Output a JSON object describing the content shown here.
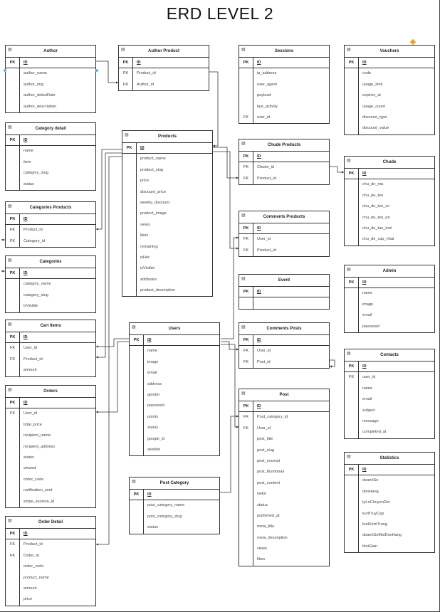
{
  "title": "ERD LEVEL 2",
  "colors": {
    "line": "#333333",
    "accent": "#f0a020",
    "handle": "#5ab4e8"
  },
  "entities": [
    {
      "id": "author",
      "name": "Author",
      "fields": [
        {
          "key": "PK",
          "name": "ID"
        },
        {
          "key": "",
          "name": "author_name"
        },
        {
          "key": "",
          "name": "author_img"
        },
        {
          "key": "",
          "name": "author_debutDate"
        },
        {
          "key": "",
          "name": "author_description"
        }
      ]
    },
    {
      "id": "author_product",
      "name": "Author Product",
      "fields": [
        {
          "key": "PK",
          "name": "ID"
        },
        {
          "key": "FK",
          "name": "Product_id"
        },
        {
          "key": "FK",
          "name": "Author_id"
        }
      ]
    },
    {
      "id": "sessions",
      "name": "Sessions",
      "fields": [
        {
          "key": "PK",
          "name": "ID"
        },
        {
          "key": "",
          "name": "ip_address"
        },
        {
          "key": "",
          "name": "user_agent"
        },
        {
          "key": "",
          "name": "payload"
        },
        {
          "key": "",
          "name": "last_activity"
        },
        {
          "key": "FK",
          "name": "user_id"
        }
      ]
    },
    {
      "id": "vouchers",
      "name": "Vouchers",
      "fields": [
        {
          "key": "PK",
          "name": "ID"
        },
        {
          "key": "",
          "name": "code"
        },
        {
          "key": "",
          "name": "usage_limit"
        },
        {
          "key": "",
          "name": "expires_at"
        },
        {
          "key": "",
          "name": "usage_count"
        },
        {
          "key": "",
          "name": "discount_type"
        },
        {
          "key": "",
          "name": "discount_value"
        }
      ]
    },
    {
      "id": "category_detail",
      "name": "Category detail",
      "fields": [
        {
          "key": "PK",
          "name": "ID"
        },
        {
          "key": "",
          "name": "name"
        },
        {
          "key": "",
          "name": "item"
        },
        {
          "key": "",
          "name": "category_slug"
        },
        {
          "key": "",
          "name": "status"
        }
      ]
    },
    {
      "id": "products",
      "name": "Products",
      "fields": [
        {
          "key": "PK",
          "name": "ID"
        },
        {
          "key": "",
          "name": "product_name"
        },
        {
          "key": "",
          "name": "product_slug"
        },
        {
          "key": "",
          "name": "price"
        },
        {
          "key": "",
          "name": "discount_price"
        },
        {
          "key": "",
          "name": "weekly_discount"
        },
        {
          "key": "",
          "name": "product_image"
        },
        {
          "key": "",
          "name": "views"
        },
        {
          "key": "",
          "name": "likes"
        },
        {
          "key": "",
          "name": "remaining"
        },
        {
          "key": "",
          "name": "isHot"
        },
        {
          "key": "",
          "name": "isVisible"
        },
        {
          "key": "",
          "name": "attributes"
        },
        {
          "key": "",
          "name": "product_description"
        }
      ]
    },
    {
      "id": "chude_products",
      "name": "Chude Products",
      "fields": [
        {
          "key": "PK",
          "name": "ID"
        },
        {
          "key": "FK",
          "name": "Chude_id"
        },
        {
          "key": "FK",
          "name": "Product_id"
        }
      ]
    },
    {
      "id": "chude",
      "name": "Chude",
      "fields": [
        {
          "key": "PK",
          "name": "ID"
        },
        {
          "key": "",
          "name": "chu_de_ma"
        },
        {
          "key": "",
          "name": "chu_de_ten"
        },
        {
          "key": "",
          "name": "chu_de_ten_vn"
        },
        {
          "key": "",
          "name": "chu_de_ten_en"
        },
        {
          "key": "",
          "name": "chu_de_tao_moi"
        },
        {
          "key": "",
          "name": "chu_de_cap_nhat"
        }
      ]
    },
    {
      "id": "categories_products",
      "name": "Categories Products",
      "fields": [
        {
          "key": "PK",
          "name": "ID"
        },
        {
          "key": "FK",
          "name": "Product_id"
        },
        {
          "key": "FK",
          "name": "Category_id"
        }
      ]
    },
    {
      "id": "comments_products",
      "name": "Comments Products",
      "fields": [
        {
          "key": "PK",
          "name": "ID"
        },
        {
          "key": "FK",
          "name": "User_id"
        },
        {
          "key": "FK",
          "name": "Product_id"
        }
      ]
    },
    {
      "id": "categories",
      "name": "Categories",
      "fields": [
        {
          "key": "PK",
          "name": "ID"
        },
        {
          "key": "",
          "name": "category_name"
        },
        {
          "key": "",
          "name": "category_slug"
        },
        {
          "key": "",
          "name": "isVisible"
        }
      ]
    },
    {
      "id": "event",
      "name": "Event",
      "fields": [
        {
          "key": "PK",
          "name": "ID"
        },
        {
          "key": "",
          "name": ""
        }
      ]
    },
    {
      "id": "admin",
      "name": "Admin",
      "fields": [
        {
          "key": "PK",
          "name": "ID"
        },
        {
          "key": "",
          "name": "name"
        },
        {
          "key": "",
          "name": "image"
        },
        {
          "key": "",
          "name": "email"
        },
        {
          "key": "",
          "name": "password"
        }
      ]
    },
    {
      "id": "cart_items",
      "name": "Cart Items",
      "fields": [
        {
          "key": "PK",
          "name": "ID"
        },
        {
          "key": "FK",
          "name": "User_id"
        },
        {
          "key": "FK",
          "name": "Product_id"
        },
        {
          "key": "",
          "name": "amount"
        }
      ]
    },
    {
      "id": "users",
      "name": "Users",
      "fields": [
        {
          "key": "PK",
          "name": "ID"
        },
        {
          "key": "",
          "name": "name"
        },
        {
          "key": "",
          "name": "image"
        },
        {
          "key": "",
          "name": "email"
        },
        {
          "key": "",
          "name": "address"
        },
        {
          "key": "",
          "name": "gender"
        },
        {
          "key": "",
          "name": "password"
        },
        {
          "key": "",
          "name": "points"
        },
        {
          "key": "",
          "name": "status"
        },
        {
          "key": "",
          "name": "google_id"
        },
        {
          "key": "",
          "name": "wishlist"
        }
      ]
    },
    {
      "id": "comments_posts",
      "name": "Comments Posts",
      "fields": [
        {
          "key": "PK",
          "name": "ID"
        },
        {
          "key": "FK",
          "name": "User_id"
        },
        {
          "key": "FK",
          "name": "Post_id"
        }
      ]
    },
    {
      "id": "contacts",
      "name": "Contacts",
      "fields": [
        {
          "key": "PK",
          "name": "ID"
        },
        {
          "key": "FK",
          "name": "user_id"
        },
        {
          "key": "",
          "name": "name"
        },
        {
          "key": "",
          "name": "email"
        },
        {
          "key": "",
          "name": "subject"
        },
        {
          "key": "",
          "name": "message"
        },
        {
          "key": "",
          "name": "completed_at"
        }
      ]
    },
    {
      "id": "orders",
      "name": "Orders",
      "fields": [
        {
          "key": "PK",
          "name": "ID"
        },
        {
          "key": "FK",
          "name": "User_id"
        },
        {
          "key": "",
          "name": "total_price"
        },
        {
          "key": "",
          "name": "recipient_name"
        },
        {
          "key": "",
          "name": "recipient_address"
        },
        {
          "key": "",
          "name": "status"
        },
        {
          "key": "",
          "name": "viewed"
        },
        {
          "key": "",
          "name": "order_code"
        },
        {
          "key": "",
          "name": "notification_sent"
        },
        {
          "key": "",
          "name": "stripe_session_id"
        }
      ]
    },
    {
      "id": "post",
      "name": "Post",
      "fields": [
        {
          "key": "PK",
          "name": "ID"
        },
        {
          "key": "FK",
          "name": "Post_category_id"
        },
        {
          "key": "FK",
          "name": "User_id"
        },
        {
          "key": "",
          "name": "post_title"
        },
        {
          "key": "",
          "name": "post_slug"
        },
        {
          "key": "",
          "name": "post_excerpt"
        },
        {
          "key": "",
          "name": "post_thumbnail"
        },
        {
          "key": "",
          "name": "post_content"
        },
        {
          "key": "",
          "name": "isHot"
        },
        {
          "key": "",
          "name": "status"
        },
        {
          "key": "",
          "name": "published_at"
        },
        {
          "key": "",
          "name": "meta_title"
        },
        {
          "key": "",
          "name": "meta_description"
        },
        {
          "key": "",
          "name": "views"
        },
        {
          "key": "",
          "name": "likes"
        }
      ]
    },
    {
      "id": "statistics",
      "name": "Statistics",
      "fields": [
        {
          "key": "PK",
          "name": "ID"
        },
        {
          "key": "",
          "name": "doanhSo"
        },
        {
          "key": "",
          "name": "donHang"
        },
        {
          "key": "",
          "name": "tyLeChuyenDoi"
        },
        {
          "key": "",
          "name": "luotTruyCap"
        },
        {
          "key": "",
          "name": "luotXemTrang"
        },
        {
          "key": "",
          "name": "doanhSoMoiDonHang"
        },
        {
          "key": "",
          "name": "thoiGian"
        }
      ]
    },
    {
      "id": "post_category",
      "name": "Post Category",
      "fields": [
        {
          "key": "PK",
          "name": "ID"
        },
        {
          "key": "",
          "name": "post_category_name"
        },
        {
          "key": "",
          "name": "post_category_slug"
        },
        {
          "key": "",
          "name": "status"
        }
      ]
    },
    {
      "id": "order_detail",
      "name": "Order Detail",
      "fields": [
        {
          "key": "PK",
          "name": "ID"
        },
        {
          "key": "FK",
          "name": "Product_id"
        },
        {
          "key": "FK",
          "name": "Order_id"
        },
        {
          "key": "",
          "name": "order_code"
        },
        {
          "key": "",
          "name": "product_name"
        },
        {
          "key": "",
          "name": "amount"
        },
        {
          "key": "",
          "name": "price"
        }
      ]
    }
  ]
}
